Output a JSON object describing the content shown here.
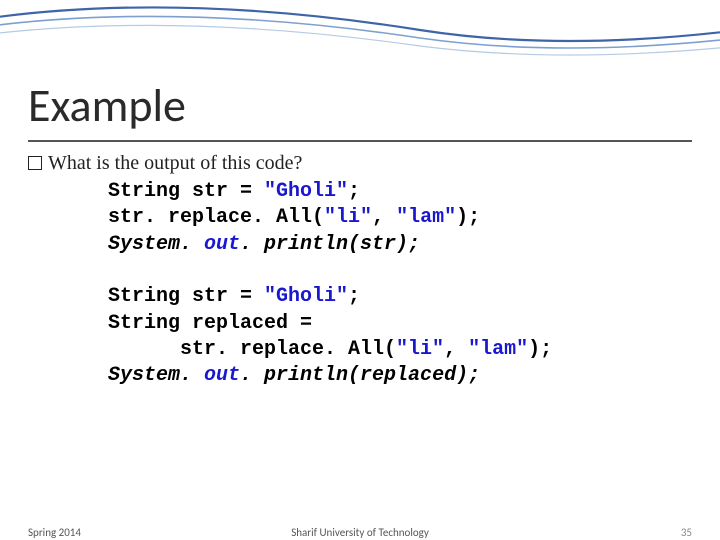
{
  "title": "Example",
  "question": "What is the output of this code?",
  "code1": {
    "l1a": "String str = ",
    "l1b": "\"Gholi\"",
    "l1c": ";",
    "l2a": "str. replace. All(",
    "l2b": "\"li\"",
    "l2c": ", ",
    "l2d": "\"lam\"",
    "l2e": ");",
    "l3a": "System. ",
    "l3b": "out",
    "l3c": ". println(str);"
  },
  "code2": {
    "l1a": "String str = ",
    "l1b": "\"Gholi\"",
    "l1c": ";",
    "l2": "String replaced =",
    "l3a": "str. replace. All(",
    "l3b": "\"li\"",
    "l3c": ", ",
    "l3d": "\"lam\"",
    "l3e": ");",
    "l4a": "System. ",
    "l4b": "out",
    "l4c": ". println(replaced);"
  },
  "footer": {
    "left": "Spring 2014",
    "center": "Sharif University of Technology",
    "right": "35"
  }
}
